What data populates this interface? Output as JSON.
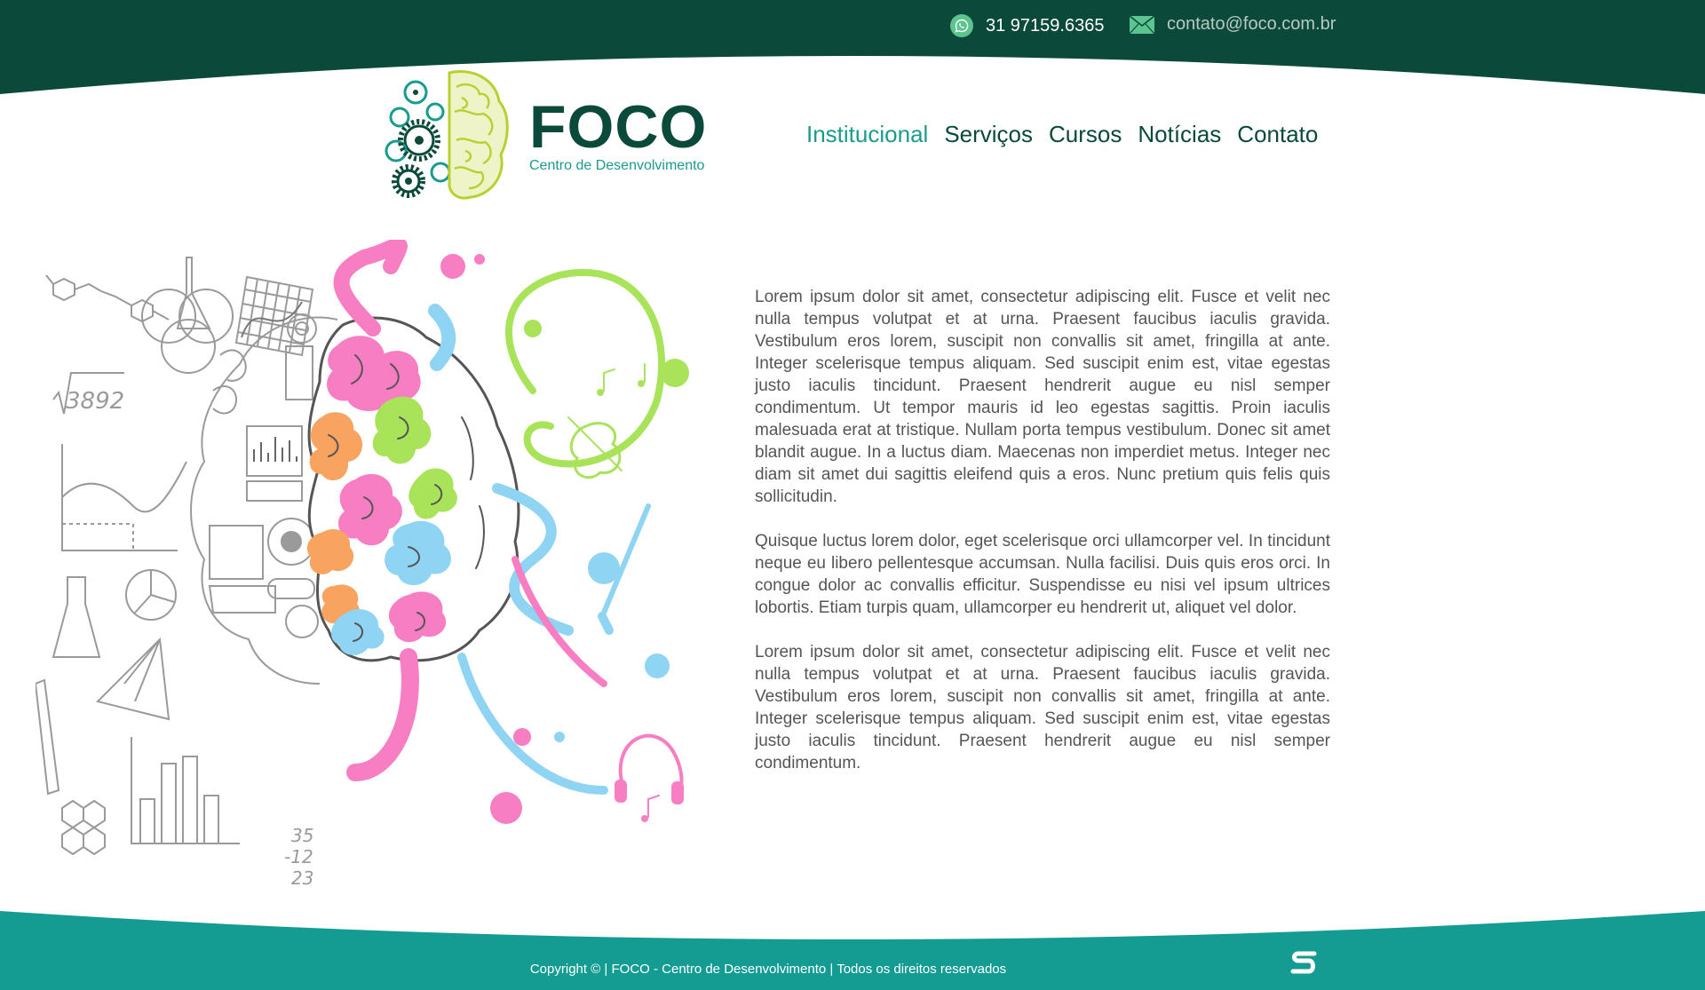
{
  "colors": {
    "dark_green": "#0b4a3a",
    "teal": "#1a9b8f",
    "footer_teal": "#149c93",
    "white": "#ffffff"
  },
  "topbar": {
    "phone": "31 97159.6365",
    "phone_icon": "whatsapp-icon",
    "email": "contato@foco.com.br",
    "email_icon": "envelope-icon"
  },
  "logo": {
    "word": "FOCO",
    "subtitle": "Centro de Desenvolvimento",
    "icon": "brain-gears-icon"
  },
  "nav": {
    "items": [
      {
        "label": "Institucional",
        "active": true
      },
      {
        "label": "Serviços"
      },
      {
        "label": "Cursos"
      },
      {
        "label": "Notícias"
      },
      {
        "label": "Contato"
      }
    ]
  },
  "illustration": {
    "icon": "brain-left-right-illustration",
    "text_3892": "3892",
    "n1": "35",
    "n2": "-12",
    "n3": "23"
  },
  "content": {
    "paragraphs": [
      "Lorem ipsum dolor sit amet, consectetur adipiscing elit. Fusce et velit nec nulla tempus volutpat et at urna. Praesent faucibus iaculis gravida. Vestibulum eros lorem, suscipit non convallis sit amet, fringilla at ante. Integer scelerisque tempus aliquam. Sed suscipit enim est, vitae egestas justo iaculis tincidunt. Praesent hendrerit augue eu nisl semper condimentum. Ut tempor mauris id leo egestas sagittis. Proin iaculis malesuada erat at tristique. Nullam porta tempus vestibulum. Donec sit amet blandit augue. In a luctus diam. Maecenas non imperdiet metus. Integer nec diam sit amet dui sagittis eleifend quis a eros. Nunc pretium quis felis quis sollicitudin.",
      "Quisque luctus lorem dolor, eget scelerisque orci ullamcorper vel. In tincidunt neque eu libero pellentesque accumsan. Nulla facilisi. Duis quis eros orci. In congue dolor ac convallis efficitur. Suspendisse eu nisi vel ipsum ultrices lobortis. Etiam turpis quam, ullamcorper eu hendrerit ut, aliquet vel dolor.",
      "Lorem ipsum dolor sit amet, consectetur adipiscing elit. Fusce et velit nec nulla tempus volutpat et at urna. Praesent faucibus iaculis gravida. Vestibulum eros lorem, suscipit non convallis sit amet, fringilla at ante. Integer scelerisque tempus aliquam. Sed suscipit enim est, vitae egestas justo iaculis tincidunt. Praesent hendrerit augue eu nisl semper condimentum."
    ]
  },
  "footer": {
    "copyright": "Copyright © | FOCO - Centro de Desenvolvimento | Todos os direitos reservados",
    "dev_logo_icon": "developer-s-logo-icon"
  }
}
